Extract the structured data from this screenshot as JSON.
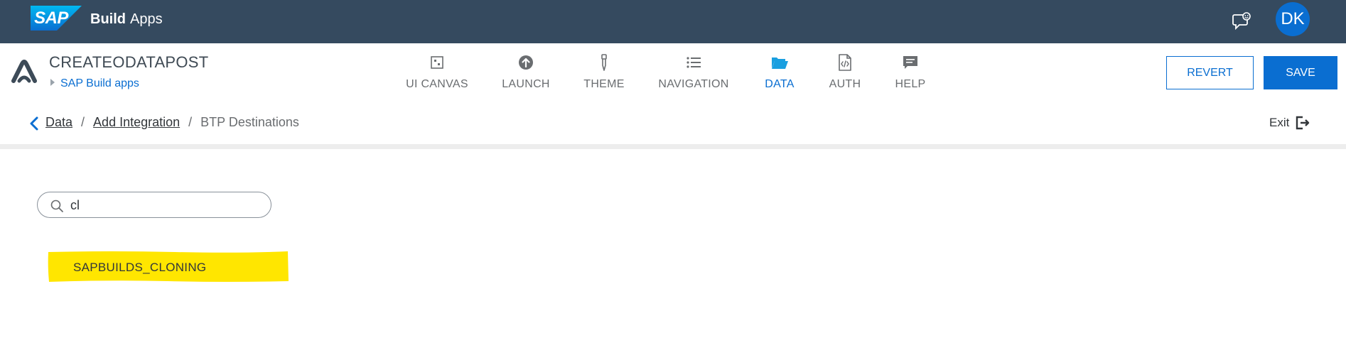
{
  "shell": {
    "logo_text": "SAP",
    "product_bold": "Build",
    "product_rest": "Apps",
    "avatar_initials": "DK",
    "colors": {
      "bar": "#354a5f",
      "avatar": "#0a6ed1"
    }
  },
  "header": {
    "project_name": "CREATEODATAPOST",
    "project_sub": "SAP Build apps",
    "nav": [
      {
        "label": "UI CANVAS",
        "icon": "canvas-icon",
        "active": false
      },
      {
        "label": "LAUNCH",
        "icon": "upload-circle-icon",
        "active": false
      },
      {
        "label": "THEME",
        "icon": "dropper-icon",
        "active": false
      },
      {
        "label": "NAVIGATION",
        "icon": "list-icon",
        "active": false
      },
      {
        "label": "DATA",
        "icon": "folder-open-icon",
        "active": true
      },
      {
        "label": "AUTH",
        "icon": "code-file-icon",
        "active": false
      },
      {
        "label": "HELP",
        "icon": "message-icon",
        "active": false
      }
    ],
    "revert_label": "REVERT",
    "save_label": "SAVE",
    "accent": "#0a6ed1"
  },
  "breadcrumb": {
    "items": [
      "Data",
      "Add Integration",
      "BTP Destinations"
    ],
    "separator": "/",
    "exit_label": "Exit"
  },
  "search": {
    "value": "cl",
    "placeholder": ""
  },
  "results": [
    {
      "label": "SAPBUILDS_CLONING",
      "highlight_color": "#ffe600"
    }
  ]
}
